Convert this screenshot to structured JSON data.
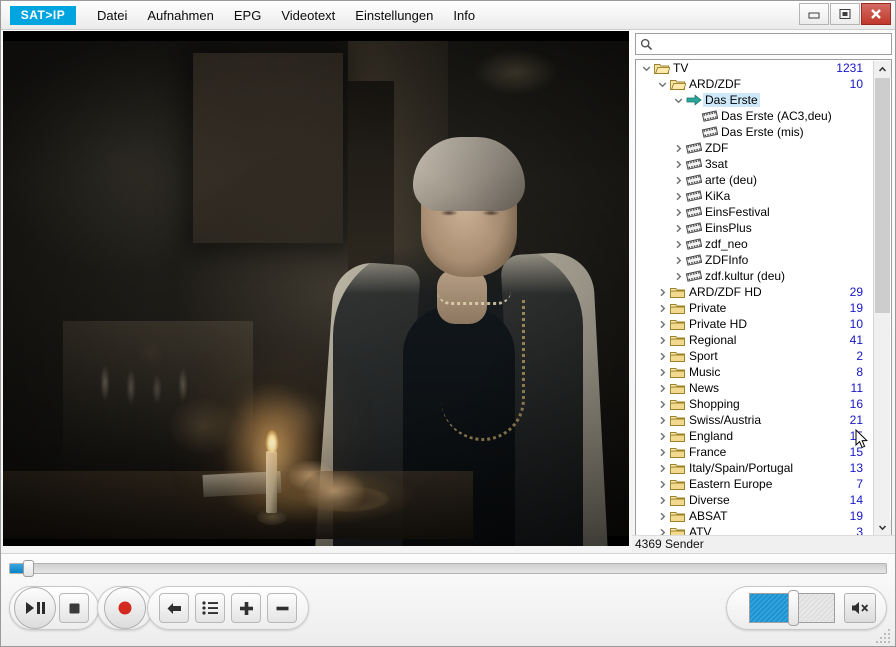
{
  "window": {
    "logo_text": "SAT>IP",
    "controls": [
      {
        "name": "minimize",
        "glyph": "minimize-icon"
      },
      {
        "name": "maximize",
        "glyph": "maximize-icon"
      },
      {
        "name": "close",
        "glyph": "close-icon",
        "color": "#c0392b"
      }
    ]
  },
  "menu": {
    "items": [
      {
        "label": "Datei"
      },
      {
        "label": "Aufnahmen"
      },
      {
        "label": "EPG"
      },
      {
        "label": "Videotext"
      },
      {
        "label": "Einstellungen"
      },
      {
        "label": "Info"
      }
    ]
  },
  "search": {
    "value": "",
    "placeholder": "",
    "icon": "search-icon"
  },
  "tree": {
    "selected": "Das Erste",
    "rows": [
      {
        "label": "TV",
        "count": "1231",
        "indent": 0,
        "icon": "folder-open-icon",
        "twisty": "expanded"
      },
      {
        "label": "ARD/ZDF",
        "count": "10",
        "indent": 1,
        "icon": "folder-open-icon",
        "twisty": "expanded"
      },
      {
        "label": "Das Erste",
        "count": "",
        "indent": 2,
        "icon": "arrow-right-icon",
        "twisty": "expanded",
        "selected": true
      },
      {
        "label": "Das Erste (AC3,deu)",
        "count": "",
        "indent": 3,
        "icon": "film-icon",
        "twisty": "none"
      },
      {
        "label": "Das Erste (mis)",
        "count": "",
        "indent": 3,
        "icon": "film-icon",
        "twisty": "none"
      },
      {
        "label": "ZDF",
        "count": "",
        "indent": 2,
        "icon": "film-icon",
        "twisty": "collapsed"
      },
      {
        "label": "3sat",
        "count": "",
        "indent": 2,
        "icon": "film-icon",
        "twisty": "collapsed"
      },
      {
        "label": "arte (deu)",
        "count": "",
        "indent": 2,
        "icon": "film-icon",
        "twisty": "collapsed"
      },
      {
        "label": "KiKa",
        "count": "",
        "indent": 2,
        "icon": "film-icon",
        "twisty": "collapsed"
      },
      {
        "label": "EinsFestival",
        "count": "",
        "indent": 2,
        "icon": "film-icon",
        "twisty": "collapsed"
      },
      {
        "label": "EinsPlus",
        "count": "",
        "indent": 2,
        "icon": "film-icon",
        "twisty": "collapsed"
      },
      {
        "label": "zdf_neo",
        "count": "",
        "indent": 2,
        "icon": "film-icon",
        "twisty": "collapsed"
      },
      {
        "label": "ZDFInfo",
        "count": "",
        "indent": 2,
        "icon": "film-icon",
        "twisty": "collapsed"
      },
      {
        "label": "zdf.kultur (deu)",
        "count": "",
        "indent": 2,
        "icon": "film-icon",
        "twisty": "collapsed"
      },
      {
        "label": "ARD/ZDF HD",
        "count": "29",
        "indent": 1,
        "icon": "folder-icon",
        "twisty": "collapsed"
      },
      {
        "label": "Private",
        "count": "19",
        "indent": 1,
        "icon": "folder-icon",
        "twisty": "collapsed"
      },
      {
        "label": "Private HD",
        "count": "10",
        "indent": 1,
        "icon": "folder-icon",
        "twisty": "collapsed"
      },
      {
        "label": "Regional",
        "count": "41",
        "indent": 1,
        "icon": "folder-icon",
        "twisty": "collapsed"
      },
      {
        "label": "Sport",
        "count": "2",
        "indent": 1,
        "icon": "folder-icon",
        "twisty": "collapsed"
      },
      {
        "label": "Music",
        "count": "8",
        "indent": 1,
        "icon": "folder-icon",
        "twisty": "collapsed"
      },
      {
        "label": "News",
        "count": "11",
        "indent": 1,
        "icon": "folder-icon",
        "twisty": "collapsed"
      },
      {
        "label": "Shopping",
        "count": "16",
        "indent": 1,
        "icon": "folder-icon",
        "twisty": "collapsed"
      },
      {
        "label": "Swiss/Austria",
        "count": "21",
        "indent": 1,
        "icon": "folder-icon",
        "twisty": "collapsed"
      },
      {
        "label": "England",
        "count": "15",
        "indent": 1,
        "icon": "folder-icon",
        "twisty": "collapsed"
      },
      {
        "label": "France",
        "count": "15",
        "indent": 1,
        "icon": "folder-icon",
        "twisty": "collapsed"
      },
      {
        "label": "Italy/Spain/Portugal",
        "count": "13",
        "indent": 1,
        "icon": "folder-icon",
        "twisty": "collapsed"
      },
      {
        "label": "Eastern Europe",
        "count": "7",
        "indent": 1,
        "icon": "folder-icon",
        "twisty": "collapsed"
      },
      {
        "label": "Diverse",
        "count": "14",
        "indent": 1,
        "icon": "folder-icon",
        "twisty": "collapsed"
      },
      {
        "label": "ABSAT",
        "count": "19",
        "indent": 1,
        "icon": "folder-icon",
        "twisty": "collapsed"
      },
      {
        "label": "ATV",
        "count": "3",
        "indent": 1,
        "icon": "folder-icon",
        "twisty": "collapsed"
      }
    ]
  },
  "status": {
    "text": "4369 Sender"
  },
  "player": {
    "seek_percent": 2,
    "volume_percent": 50,
    "buttons": [
      {
        "name": "play-pause-button",
        "icon": "play-pause-icon"
      },
      {
        "name": "stop-button",
        "icon": "stop-icon"
      },
      {
        "name": "record-button",
        "icon": "record-icon"
      },
      {
        "name": "back-button",
        "icon": "arrow-left-icon"
      },
      {
        "name": "playlist-button",
        "icon": "list-icon"
      },
      {
        "name": "add-button",
        "icon": "plus-icon"
      },
      {
        "name": "remove-button",
        "icon": "minus-icon"
      }
    ],
    "mute": {
      "name": "mute-button",
      "icon": "speaker-mute-icon"
    }
  },
  "colors": {
    "accent": "#00a5e0",
    "count_text": "#1616c8",
    "selection": "#cde8f8",
    "close_red": "#c0392b"
  }
}
